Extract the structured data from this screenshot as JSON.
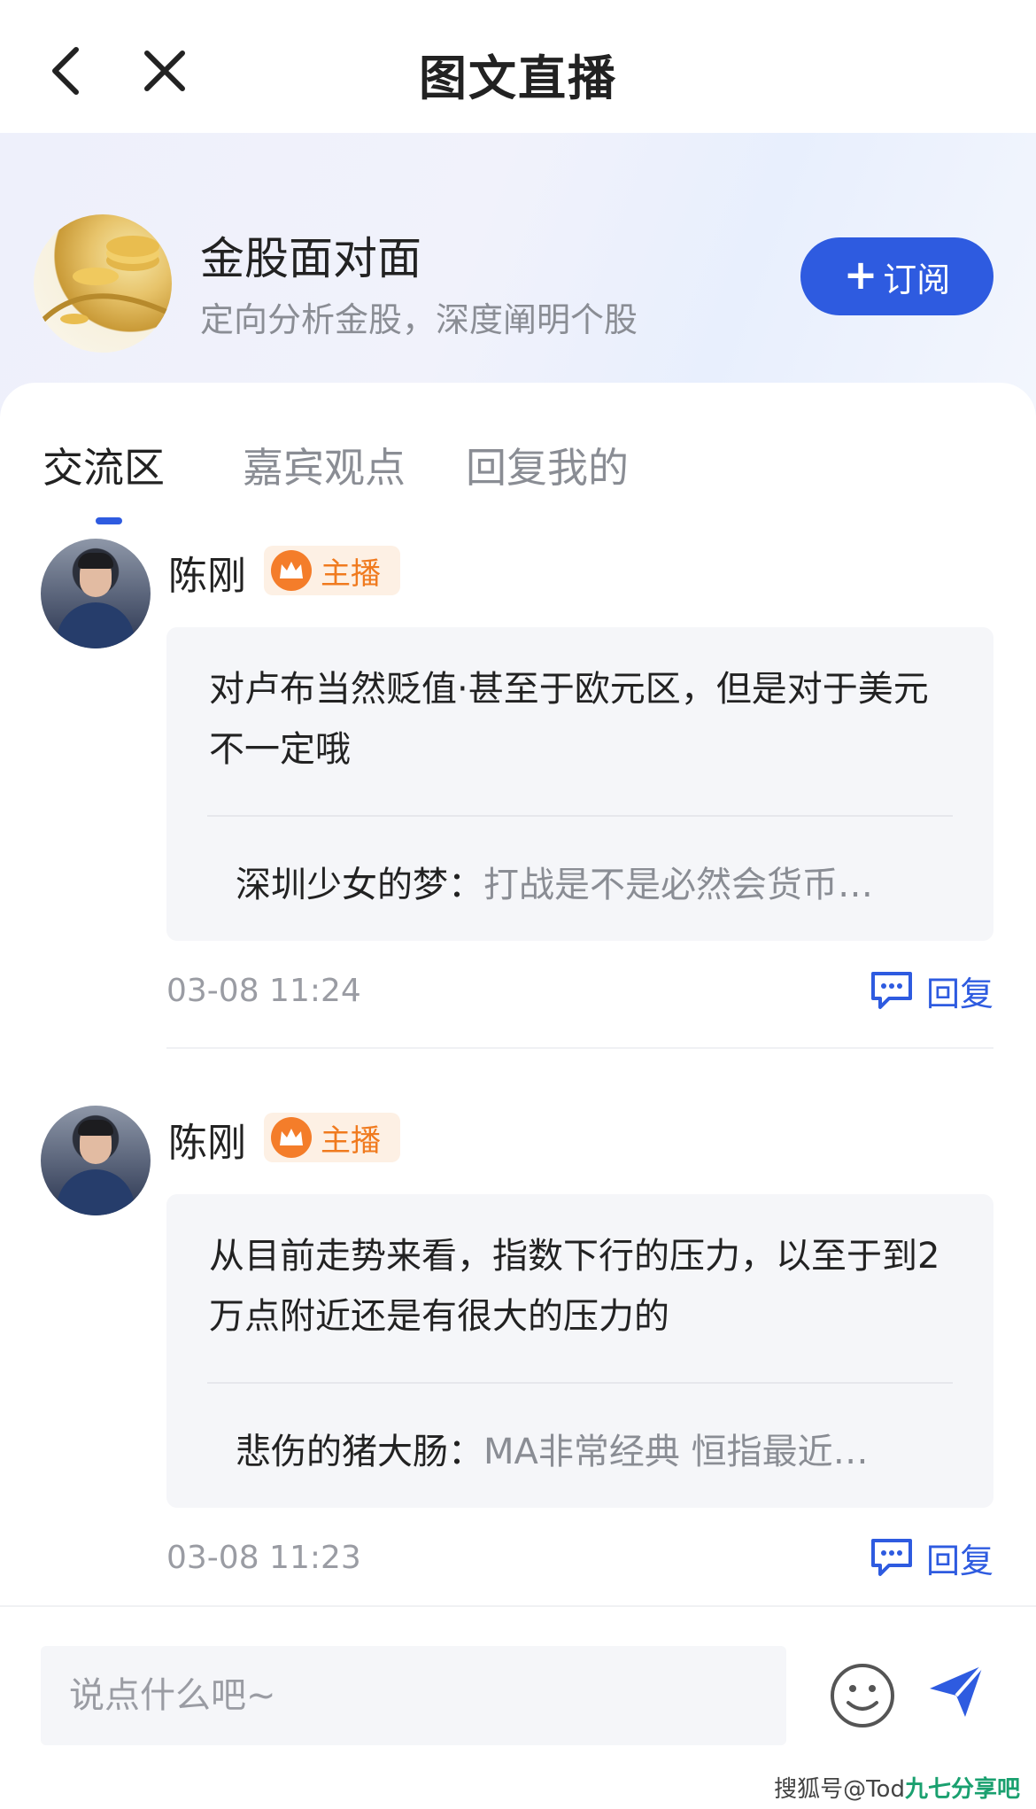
{
  "nav": {
    "title": "图文直播"
  },
  "channel": {
    "name": "金股面对面",
    "description": "定向分析金股，深度阐明个股",
    "subscribe_label": "订阅",
    "subscribe_plus": "+"
  },
  "tabs": [
    {
      "label": "交流区",
      "active": true
    },
    {
      "label": "嘉宾观点",
      "active": false
    },
    {
      "label": "回复我的",
      "active": false
    }
  ],
  "posts": [
    {
      "author": "陈刚",
      "badge": "主播",
      "content": "对卢布当然贬值·甚至于欧元区，但是对于美元不一定哦",
      "quote_author": "深圳少女的梦：",
      "quote_text": "打战是不是必然会货币…",
      "time": "03-08 11:24",
      "reply_label": "回复"
    },
    {
      "author": "陈刚",
      "badge": "主播",
      "content": "从目前走势来看，指数下行的压力，以至于到2万点附近还是有很大的压力的",
      "quote_author": "悲伤的猪大肠：",
      "quote_text": "MA非常经典 恒指最近…",
      "time": "03-08 11:23",
      "reply_label": "回复"
    }
  ],
  "input": {
    "placeholder": "说点什么吧~"
  },
  "watermark": {
    "text": "搜狐号@Tod",
    "brand": "九七分享吧"
  },
  "colors": {
    "accent": "#2e5be0",
    "badge": "#f07a1e",
    "bubble": "#f5f6f9"
  }
}
